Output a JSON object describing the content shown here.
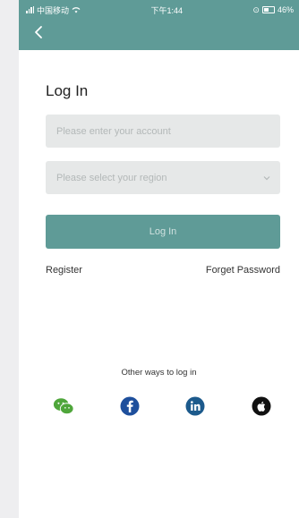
{
  "status_bar": {
    "carrier": "中国移动",
    "time": "下午1:44",
    "battery": "46%"
  },
  "login": {
    "title": "Log In",
    "account_placeholder": "Please enter your account",
    "region_placeholder": "Please select your region",
    "submit_label": "Log In",
    "register_label": "Register",
    "forgot_label": "Forget Password",
    "other_ways_label": "Other ways to log in"
  },
  "social": [
    "wechat-icon",
    "facebook-icon",
    "linkedin-icon",
    "apple-icon"
  ],
  "colors": {
    "primary": "#5f9b97",
    "field_bg": "#e6e8e8",
    "wechat": "#4fa63b",
    "facebook": "#1e4f9c",
    "linkedin": "#1c5a8c"
  }
}
